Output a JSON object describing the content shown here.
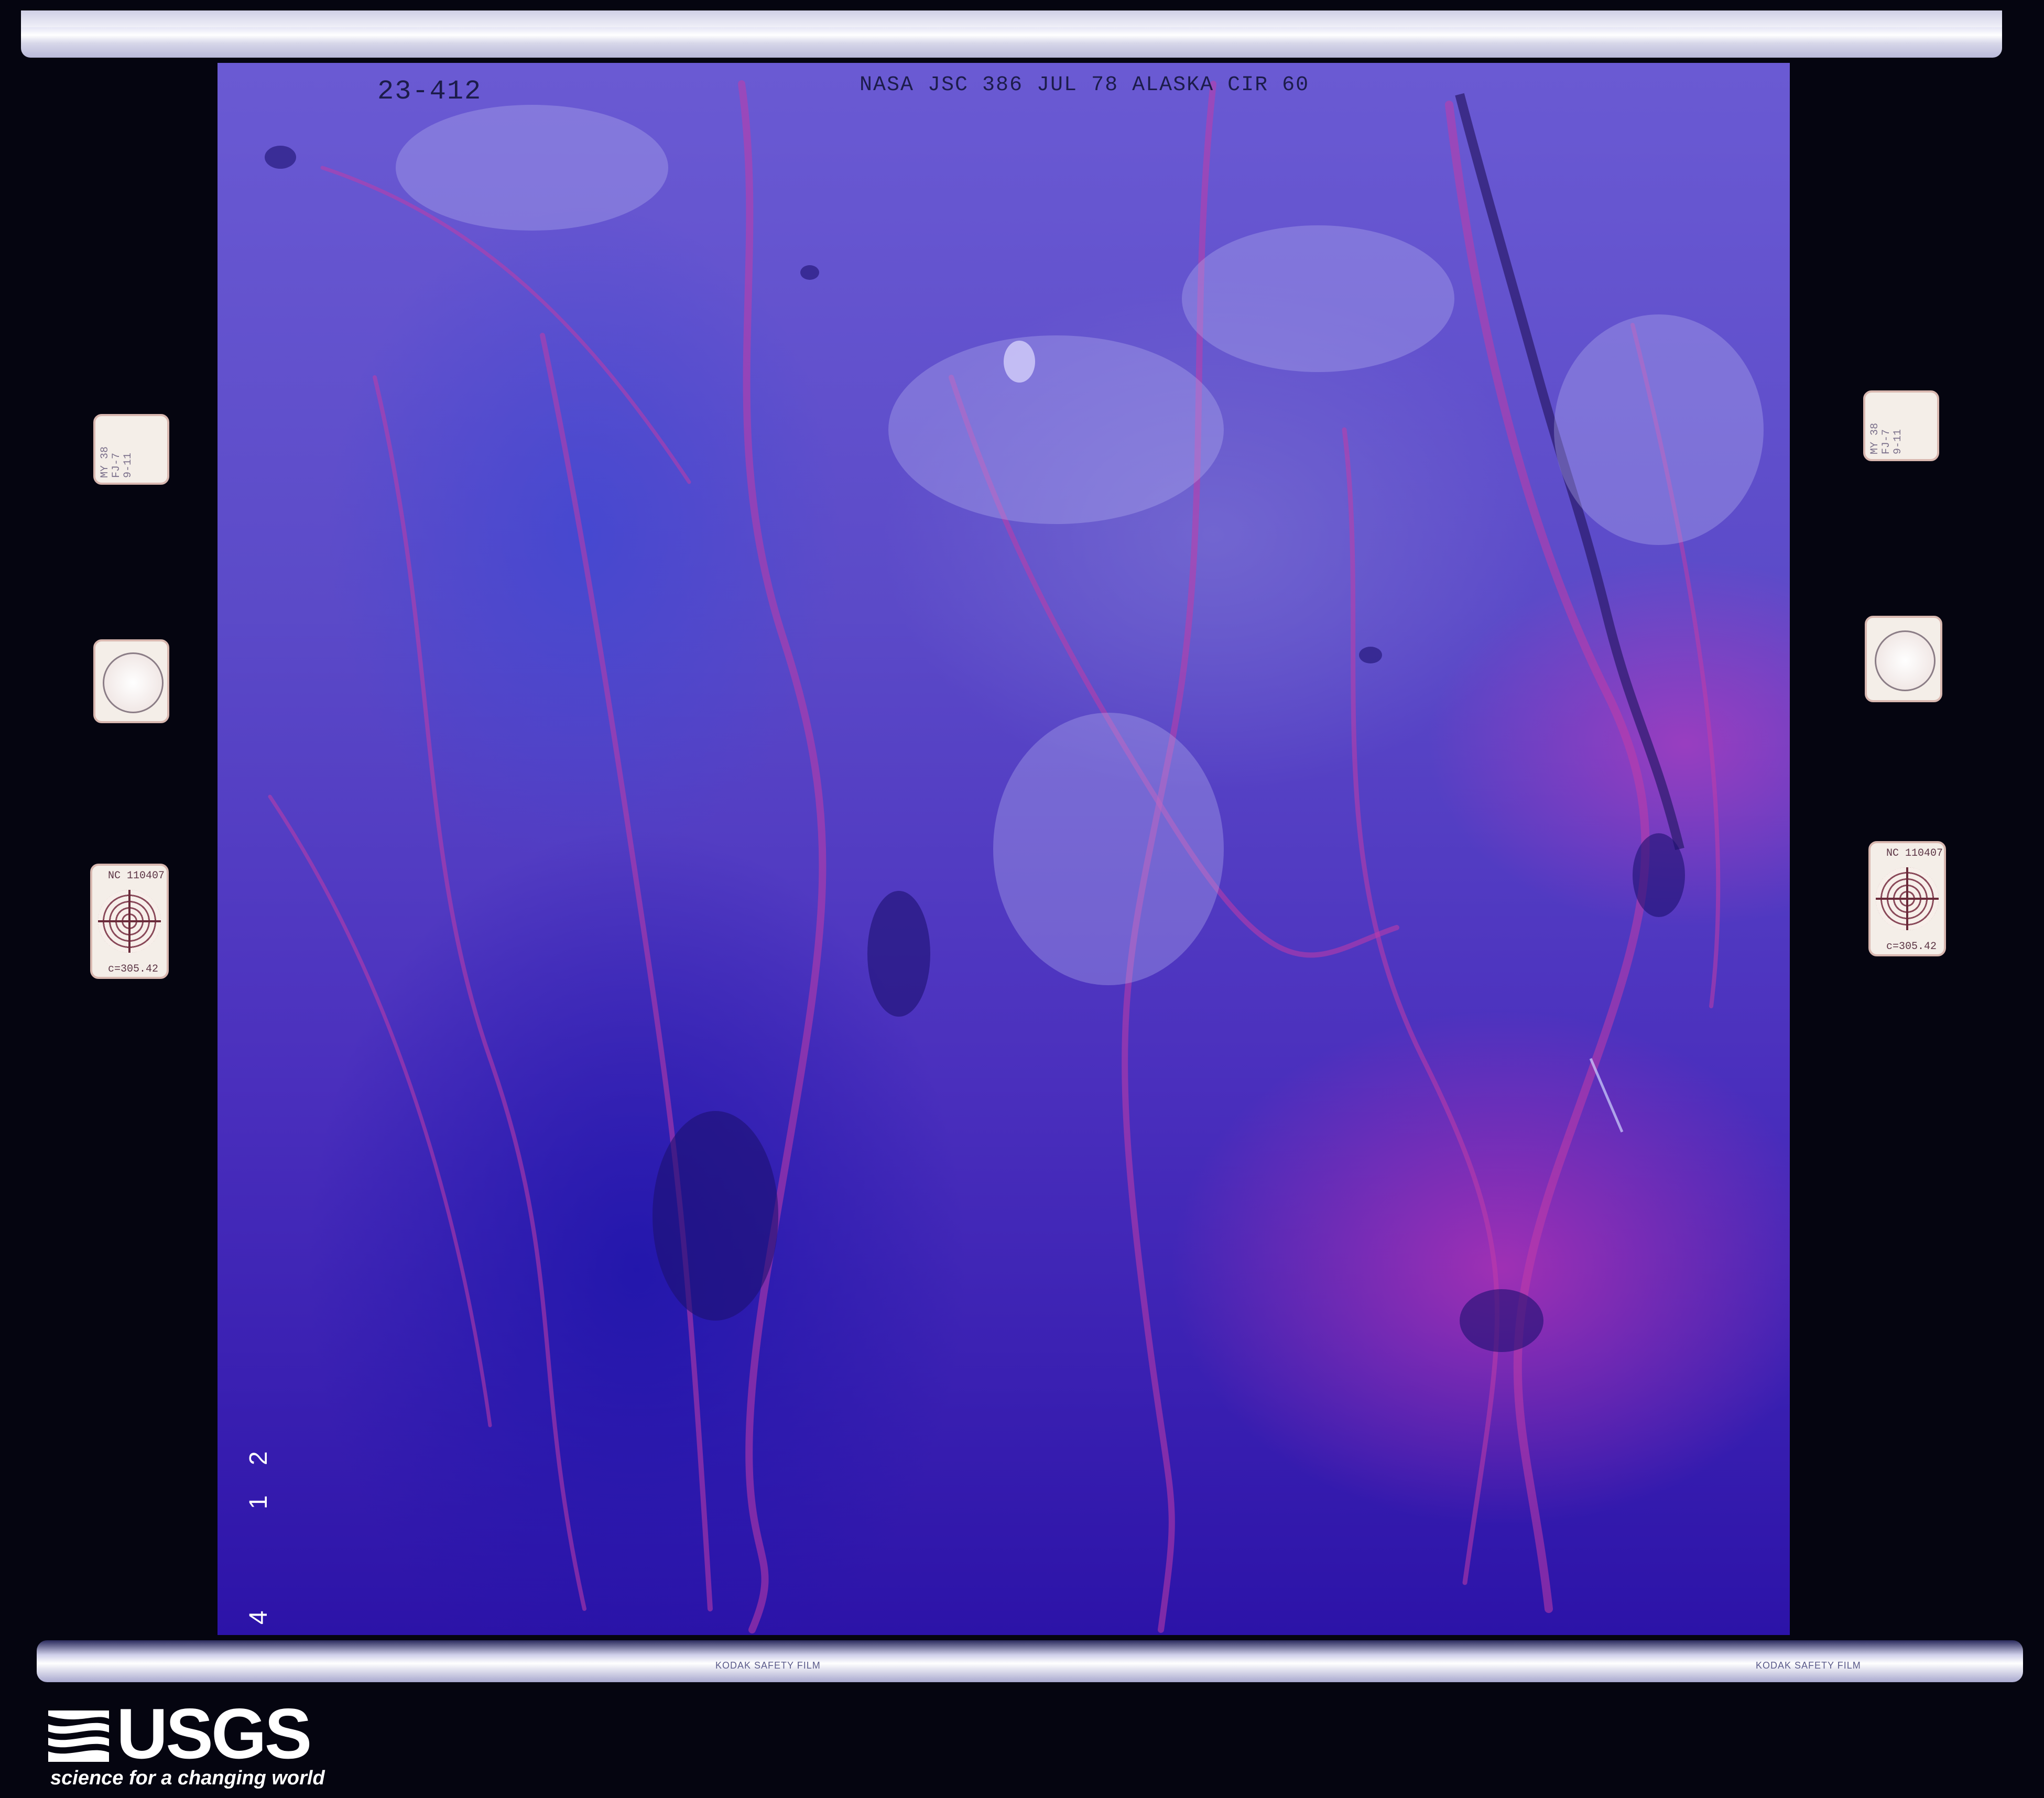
{
  "photo": {
    "frame_id": "23-412",
    "title": "NASA JSC 386 JUL 78 ALASKA CIR 60",
    "side_number": "1 2",
    "side_number_fragment": "4",
    "left_note": "MY 38\nFJ-7\n9-11",
    "right_note": "MY 38\nFJ-7\n9-11",
    "left_code_top": "NC 110407",
    "left_code_bottom": "c=305.42",
    "right_code_top": "NC 110407",
    "right_code_bottom": "c=305.42",
    "film_stock_left": "KODAK SAFETY FILM",
    "film_stock_right": "KODAK SAFETY FILM"
  },
  "logo": {
    "wordmark": "USGS",
    "tagline": "science for a changing world"
  },
  "colors": {
    "background": "#050510",
    "terrain_blue": "#4a2fbd",
    "terrain_magenta": "#b032b4",
    "logo": "#ffffff"
  }
}
